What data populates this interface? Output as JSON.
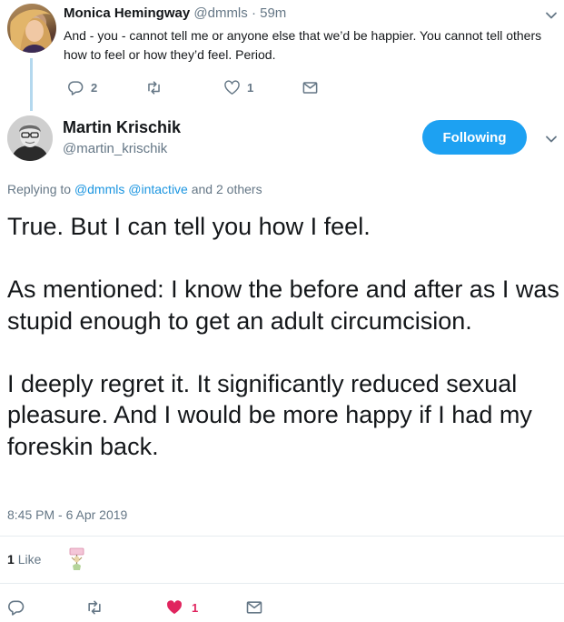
{
  "parent": {
    "name": "Monica Hemingway",
    "handle": "@dmmls",
    "dot": "·",
    "time": "59m",
    "text": "And - you - cannot tell me or anyone else that we’d be happier. You cannot tell others how to feel or how they’d feel. Period.",
    "reply_count": "2",
    "retweet_count": "",
    "like_count": "1"
  },
  "tweet": {
    "name": "Martin Krischik",
    "handle": "@martin_krischik",
    "follow_label": "Following",
    "replying_prefix": "Replying to",
    "replying_mention_1": "@dmmls",
    "replying_mention_2": "@intactive",
    "replying_suffix": "and 2 others",
    "paragraphs": [
      "True. But I can tell you how I feel.",
      "As mentioned: I know the before and after as I was stupid enough to get an adult circumcision.",
      "I deeply regret it. It significantly reduced sexual pleasure. And I would be more happy if I had my foreskin back."
    ],
    "timestamp": "8:45 PM - 6 Apr 2019",
    "likes_count": "1",
    "likes_label": "Like",
    "like_count_action": "1"
  },
  "colors": {
    "accent": "#1da1f2",
    "link": "#1b95e0",
    "secondary_text": "#657786",
    "like_red": "#e0245e",
    "thread_line": "#b4d8ee"
  },
  "icons": {
    "chevron": "chevron-down-icon",
    "reply": "reply-icon",
    "retweet": "retweet-icon",
    "like": "heart-icon",
    "message": "direct-message-icon"
  }
}
